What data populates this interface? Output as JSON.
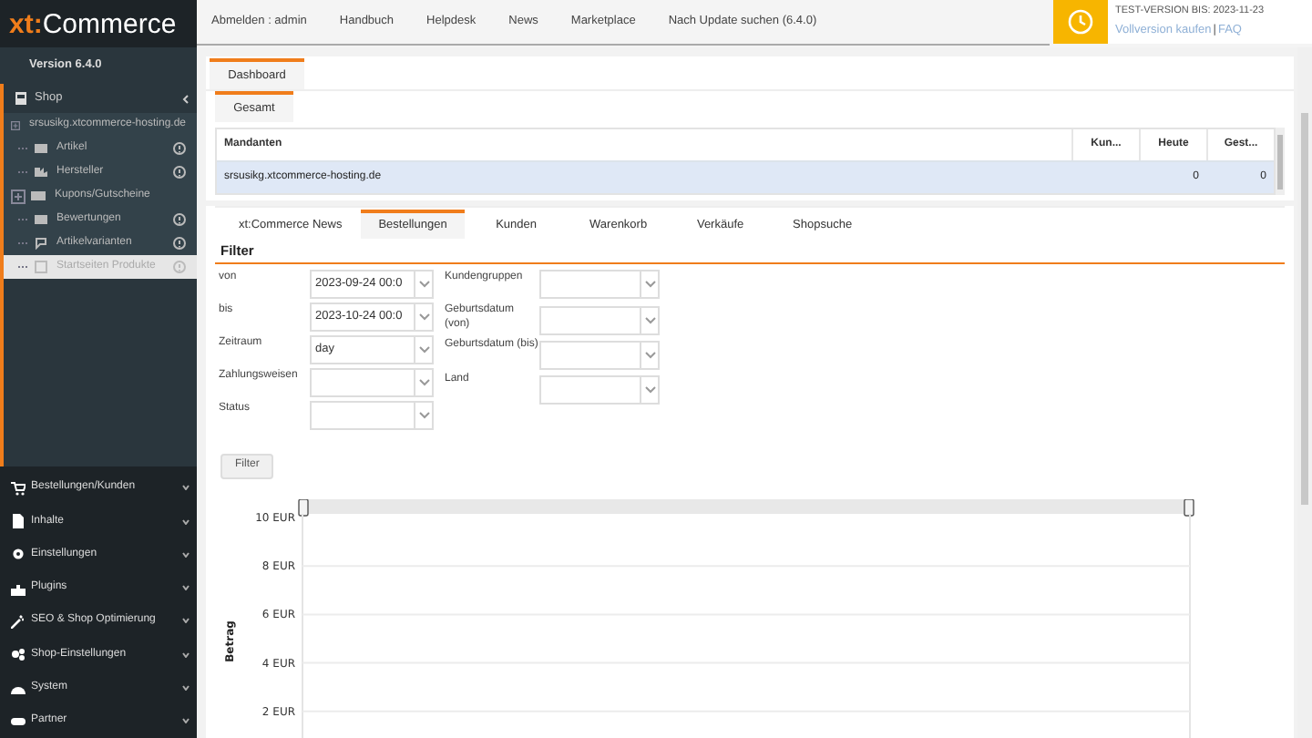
{
  "header": {
    "logo": {
      "prefix": "xt:",
      "name": "Commerce"
    },
    "nav": [
      "Abmelden : admin",
      "Handbuch",
      "Helpdesk",
      "News",
      "Marketplace",
      "Nach Update suchen (6.4.0)"
    ],
    "trial": {
      "text": "TEST-VERSION BIS: 2023-11-23",
      "links": [
        "Vollversion kaufen",
        "FAQ"
      ],
      "separator": "|"
    }
  },
  "sidebar": {
    "version": "Version 6.4.0",
    "shop": {
      "label": "Shop",
      "expanded": true
    },
    "tree": [
      {
        "label": "srsusikg.xtcommerce-hosting.de",
        "kind": "folder",
        "help": false,
        "selected": false
      },
      {
        "label": "Artikel",
        "kind": "leaf",
        "help": true,
        "selected": false
      },
      {
        "label": "Hersteller",
        "kind": "leaf",
        "help": true,
        "selected": false
      },
      {
        "label": "Kupons/Gutscheine",
        "kind": "folder",
        "help": false,
        "selected": false
      },
      {
        "label": "Bewertungen",
        "kind": "leaf",
        "help": true,
        "selected": false
      },
      {
        "label": "Artikelvarianten",
        "kind": "leaf",
        "help": true,
        "selected": false
      },
      {
        "label": "Startseiten Produkte",
        "kind": "leaf",
        "help": true,
        "selected": true
      }
    ],
    "menu": [
      "Bestellungen/Kunden",
      "Inhalte",
      "Einstellungen",
      "Plugins",
      "SEO & Shop Optimierung",
      "Shop-Einstellungen",
      "System",
      "Partner"
    ]
  },
  "main": {
    "tabs": [
      {
        "label": "Dashboard",
        "selected": true
      }
    ],
    "subtabs": [
      {
        "label": "Gesamt",
        "selected": true
      }
    ],
    "grid": {
      "columns": [
        "Mandanten",
        "Kun...",
        "Heute",
        "Gest..."
      ],
      "rows": [
        {
          "mandant": "srsusikg.xtcommerce-hosting.de",
          "heute": "0",
          "gestern": "0",
          "selected": true
        }
      ]
    },
    "report_tabs": [
      {
        "label": "xt:Commerce News",
        "selected": false
      },
      {
        "label": "Bestellungen",
        "selected": true
      },
      {
        "label": "Kunden",
        "selected": false
      },
      {
        "label": "Warenkorb",
        "selected": false
      },
      {
        "label": "Verkäufe",
        "selected": false
      },
      {
        "label": "Shopsuche",
        "selected": false
      }
    ],
    "filter": {
      "title": "Filter",
      "left": [
        {
          "label": "von",
          "value": "2023-09-24 00:0"
        },
        {
          "label": "bis",
          "value": "2023-10-24 00:0"
        },
        {
          "label": "Zeitraum",
          "value": "day"
        },
        {
          "label": "Zahlungsweisen"
        },
        {
          "label": "Status"
        }
      ],
      "right": [
        {
          "label": "Kundengruppen"
        },
        {
          "label": "Geburtsdatum (von)"
        },
        {
          "label": "Geburtsdatum (bis)"
        },
        {
          "label": "Land"
        }
      ],
      "button": "Filter"
    },
    "chart": {
      "axis_title": "Betrag",
      "axis_labels": [
        "10 EUR",
        "8 EUR",
        "6 EUR",
        "4 EUR",
        "2 EUR"
      ]
    }
  }
}
